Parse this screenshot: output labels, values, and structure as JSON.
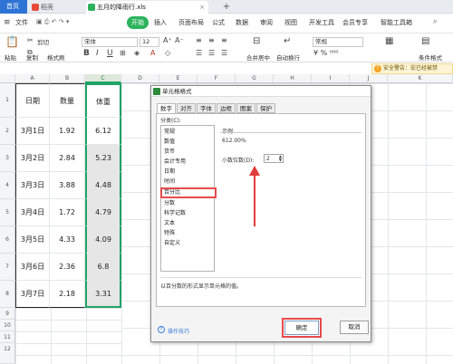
{
  "tabs": {
    "home": "首页",
    "daoke": "稻壳",
    "file": "五月的降雨行.xls",
    "close": "×",
    "add": "+"
  },
  "menu": [
    "文件",
    "开始",
    "插入",
    "页面布局",
    "公式",
    "数据",
    "审阅",
    "视图",
    "开发工具",
    "会员专享",
    "智能工具箱"
  ],
  "menu_active": "开始",
  "ribbon": {
    "cut": "剪切",
    "copy": "复制",
    "paste": "粘贴",
    "format_painter": "格式刷",
    "font_name": "宋体",
    "font_size": "12",
    "merge": "合并居中",
    "wrap": "自动换行",
    "general": "常规",
    "cond_format": "条件格式"
  },
  "warning": {
    "text": "安全警告：宏已经被禁"
  },
  "sheet": {
    "columns": [
      "A",
      "B",
      "C",
      "D",
      "E",
      "F",
      "G",
      "H",
      "I",
      "J",
      "K"
    ],
    "rows": [
      "1",
      "2",
      "3",
      "4",
      "5",
      "6",
      "7",
      "8",
      "9",
      "10",
      "11",
      "12"
    ],
    "header": [
      "日期",
      "数量",
      "体重"
    ],
    "data": [
      [
        "3月1日",
        "1.92",
        "6.12"
      ],
      [
        "3月2日",
        "2.84",
        "5.23"
      ],
      [
        "3月3日",
        "3.88",
        "4.48"
      ],
      [
        "3月4日",
        "1.72",
        "4.79"
      ],
      [
        "3月5日",
        "4.33",
        "4.09"
      ],
      [
        "3月6日",
        "2.36",
        "6.8"
      ],
      [
        "3月7日",
        "2.18",
        "3.31"
      ]
    ]
  },
  "dialog": {
    "title": "单元格格式",
    "tabs": [
      "数字",
      "对齐",
      "字体",
      "边框",
      "图案",
      "保护"
    ],
    "category_label": "分类(C):",
    "categories": [
      "常规",
      "数值",
      "货币",
      "会计专用",
      "日期",
      "时间",
      "百分比",
      "分数",
      "科学记数",
      "文本",
      "特殊",
      "自定义"
    ],
    "selected_category": "百分比",
    "sample_label": "示例",
    "sample_value": "612.00%",
    "decimals_label": "小数位数(D):",
    "decimals_value": "2",
    "description": "以百分数的形式显示单元格的值。",
    "tips_link": "操作技巧",
    "ok": "确定",
    "cancel": "取消"
  },
  "colors": {
    "accent_green": "#21a366",
    "highlight_red": "#e94a4a",
    "tab_blue": "#2e74d6"
  }
}
